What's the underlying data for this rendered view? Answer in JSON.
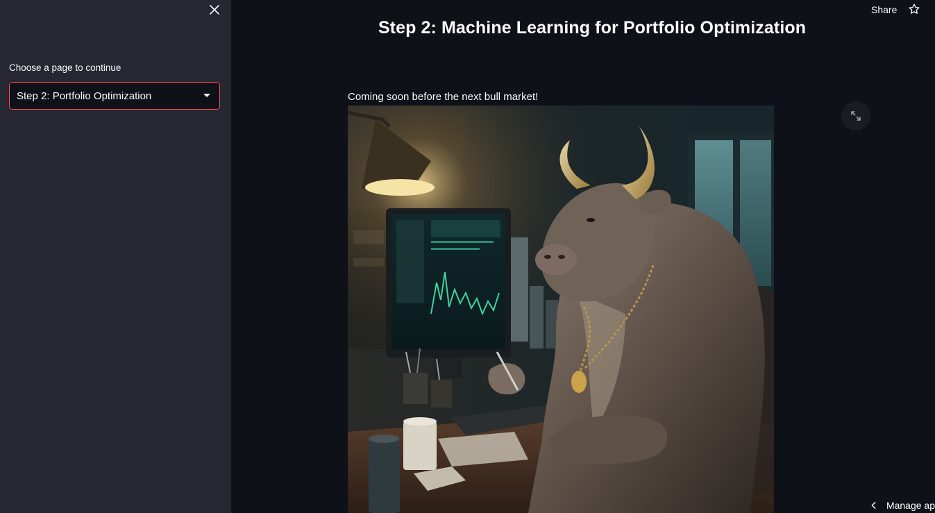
{
  "sidebar": {
    "select_label": "Choose a page to continue",
    "select_value": "Step 2: Portfolio Optimization",
    "accent_color": "#ff4b4b",
    "close_icon": "close-icon"
  },
  "toolbar": {
    "share_label": "Share",
    "star_icon": "star-icon"
  },
  "main": {
    "title": "Step 2: Machine Learning for Portfolio Optimization",
    "body_text": "Coming soon before the next bull market!",
    "image_subject": "bull-trader-illustration",
    "fullscreen_icon": "expand-icon"
  },
  "footer": {
    "manage_label": "Manage ap",
    "chevron_icon": "chevron-left-icon"
  }
}
